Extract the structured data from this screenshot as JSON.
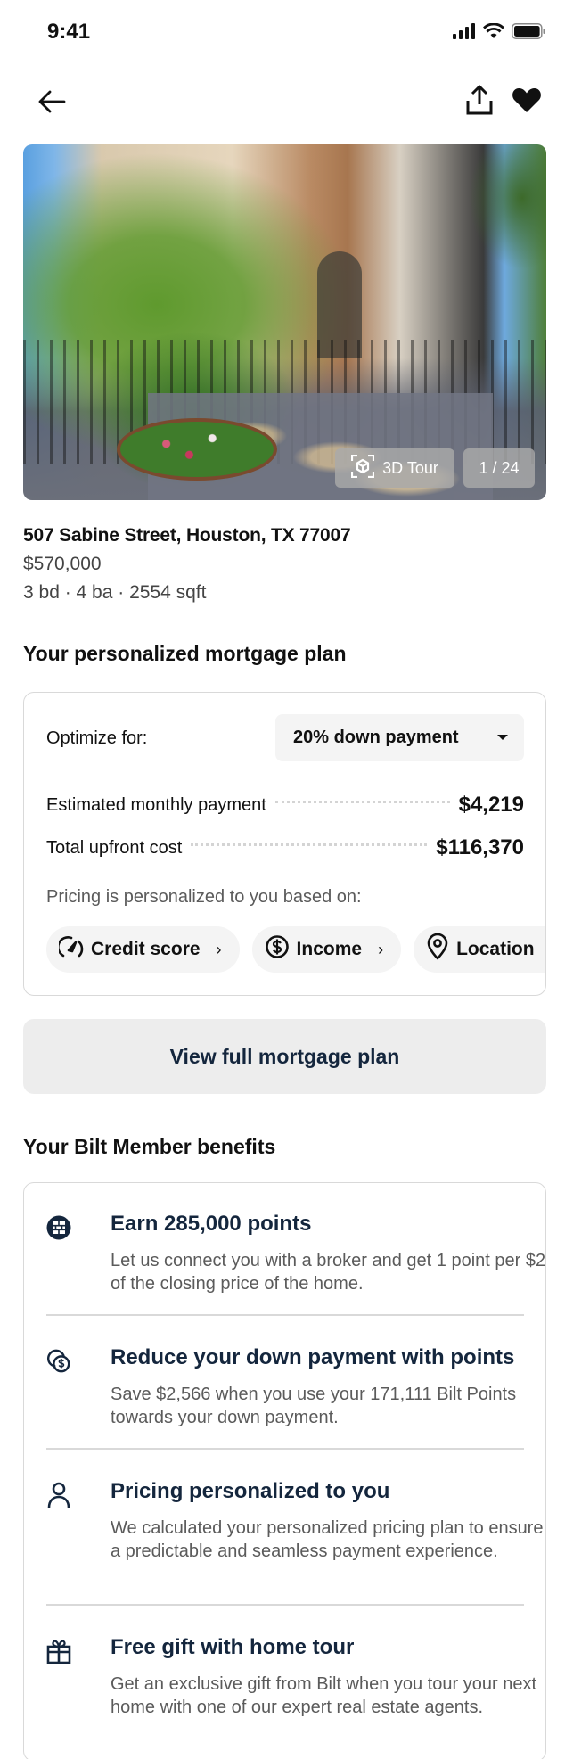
{
  "status_bar": {
    "time": "9:41",
    "icons": [
      "cellular-signal-icon",
      "wifi-icon",
      "battery-icon"
    ]
  },
  "nav": {
    "back_icon": "arrow-left-icon",
    "share_icon": "share-upload-icon",
    "favorite_icon": "heart-filled-icon"
  },
  "listing": {
    "photo_badges": {
      "tour_label": "3D Tour",
      "tour_icon": "3d-cube-scan-icon",
      "photo_counter": "1 / 24"
    },
    "address": "507 Sabine Street, Houston, TX 77007",
    "price": "$570,000",
    "specs": "3 bd · 4 ba · 2554 sqft"
  },
  "mortgage": {
    "section_title": "Your personalized mortgage plan",
    "optimize_label": "Optimize for:",
    "optimize_selected": "20% down payment",
    "rows": [
      {
        "label": "Estimated monthly payment",
        "value": "$4,219"
      },
      {
        "label": "Total upfront cost",
        "value": "$116,370"
      }
    ],
    "pricing_note": "Pricing is personalized to you based on:",
    "chips": [
      {
        "label": "Credit score",
        "icon": "speedometer-icon"
      },
      {
        "label": "Income",
        "icon": "dollar-circle-icon"
      },
      {
        "label": "Location",
        "icon": "location-pin-icon"
      }
    ],
    "view_plan_button": "View full mortgage plan"
  },
  "benefits": {
    "section_title": "Your Bilt Member benefits",
    "items": [
      {
        "icon": "bilt-brick-icon",
        "title": "Earn 285,000 points",
        "description": "Let us connect you with a broker and get 1 point per $2 of the closing price of the home."
      },
      {
        "icon": "coins-dollar-icon",
        "title": "Reduce your down payment with points",
        "description": "Save $2,566 when you use your 171,111 Bilt Points towards your down payment."
      },
      {
        "icon": "person-icon",
        "title": "Pricing personalized to you",
        "description": "We calculated your personalized pricing plan to ensure a predictable and seamless payment experience."
      },
      {
        "icon": "gift-icon",
        "title": "Free gift with home tour",
        "description": "Get an exclusive gift from Bilt when you tour your next home with one of our expert real estate agents."
      }
    ]
  },
  "colors": {
    "navy_text": "#14263d",
    "secondary_text": "#5b5b5b",
    "border": "#d9d9d9",
    "chip_bg": "#f4f4f4",
    "button_bg": "#ededed"
  }
}
